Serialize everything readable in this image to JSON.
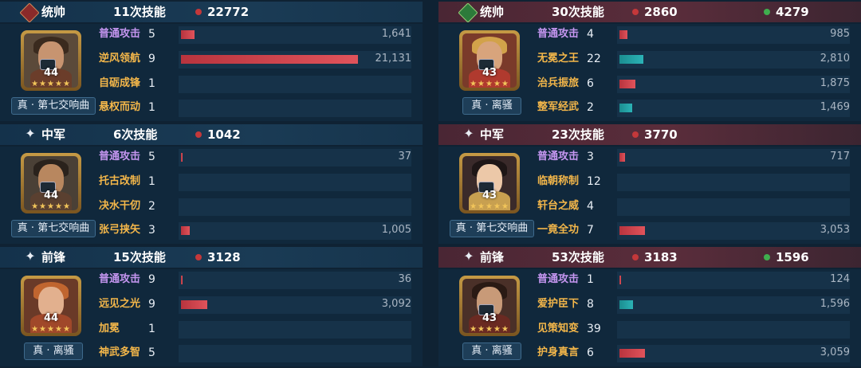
{
  "colors": {
    "left_header": "#1a3b55",
    "right_header": "#5a2d3b",
    "damage_bar": "#d84a52",
    "heal_bar": "#2bb3b6",
    "damage_dot": "#c4383a",
    "heal_dot": "#3fae4e",
    "normal_skill": "#c596f0",
    "skill": "#f4b74a"
  },
  "left": {
    "commander": {
      "role": "统帅",
      "casts": "11次技能",
      "damage": "22772",
      "level": "44",
      "stars": "★★★★★",
      "tag": "真 · 第七交响曲",
      "skills": [
        {
          "name": "普通攻击",
          "count": "5",
          "value": "1,641",
          "bar_fraction": 0.078,
          "bar_type": "damage"
        },
        {
          "name": "逆风领航",
          "count": "9",
          "value": "21,131",
          "bar_fraction": 1.0,
          "bar_type": "damage"
        },
        {
          "name": "自砺成锋",
          "count": "1",
          "value": "",
          "bar_fraction": 0,
          "bar_type": "damage"
        },
        {
          "name": "悬权而动",
          "count": "1",
          "value": "",
          "bar_fraction": 0,
          "bar_type": "damage"
        }
      ]
    },
    "middle": {
      "role": "中军",
      "casts": "6次技能",
      "damage": "1042",
      "level": "44",
      "stars": "★★★★★",
      "tag": "真 · 第七交响曲",
      "skills": [
        {
          "name": "普通攻击",
          "count": "5",
          "value": "37",
          "bar_fraction": 0.005,
          "bar_type": "damage"
        },
        {
          "name": "托古改制",
          "count": "1",
          "value": "",
          "bar_fraction": 0,
          "bar_type": "damage"
        },
        {
          "name": "决水干仞",
          "count": "2",
          "value": "",
          "bar_fraction": 0,
          "bar_type": "damage"
        },
        {
          "name": "张弓挟矢",
          "count": "3",
          "value": "1,005",
          "bar_fraction": 0.05,
          "bar_type": "damage"
        }
      ]
    },
    "vanguard": {
      "role": "前锋",
      "casts": "15次技能",
      "damage": "3128",
      "level": "44",
      "stars": "★★★★★",
      "tag": "真 · 离骚",
      "skills": [
        {
          "name": "普通攻击",
          "count": "9",
          "value": "36",
          "bar_fraction": 0.005,
          "bar_type": "damage"
        },
        {
          "name": "远见之光",
          "count": "9",
          "value": "3,092",
          "bar_fraction": 0.15,
          "bar_type": "damage"
        },
        {
          "name": "加冕",
          "count": "1",
          "value": "",
          "bar_fraction": 0,
          "bar_type": "damage"
        },
        {
          "name": "神武多智",
          "count": "5",
          "value": "",
          "bar_fraction": 0,
          "bar_type": "damage"
        }
      ]
    }
  },
  "right": {
    "commander": {
      "role": "统帅",
      "casts": "30次技能",
      "damage": "2860",
      "heal": "4279",
      "level": "43",
      "stars": "★★★★★",
      "tag": "真 · 离骚",
      "skills": [
        {
          "name": "普通攻击",
          "count": "4",
          "value": "985",
          "bar_fraction": 0.045,
          "bar_type": "damage"
        },
        {
          "name": "无冕之王",
          "count": "22",
          "value": "2,810",
          "bar_fraction": 0.135,
          "bar_type": "heal"
        },
        {
          "name": "治兵振旅",
          "count": "6",
          "value": "1,875",
          "bar_fraction": 0.09,
          "bar_type": "damage"
        },
        {
          "name": "整军经武",
          "count": "2",
          "value": "1,469",
          "bar_fraction": 0.07,
          "bar_type": "heal"
        }
      ]
    },
    "middle": {
      "role": "中军",
      "casts": "23次技能",
      "damage": "3770",
      "level": "43",
      "stars": "★★★★★",
      "tag": "真 · 第七交响曲",
      "skills": [
        {
          "name": "普通攻击",
          "count": "3",
          "value": "717",
          "bar_fraction": 0.033,
          "bar_type": "damage"
        },
        {
          "name": "临朝称制",
          "count": "12",
          "value": "",
          "bar_fraction": 0,
          "bar_type": "damage"
        },
        {
          "name": "轩台之威",
          "count": "4",
          "value": "",
          "bar_fraction": 0,
          "bar_type": "damage"
        },
        {
          "name": "一竟全功",
          "count": "7",
          "value": "3,053",
          "bar_fraction": 0.145,
          "bar_type": "damage"
        }
      ]
    },
    "vanguard": {
      "role": "前锋",
      "casts": "53次技能",
      "damage": "3183",
      "heal": "1596",
      "level": "43",
      "stars": "★★★★★",
      "tag": "真 · 离骚",
      "skills": [
        {
          "name": "普通攻击",
          "count": "1",
          "value": "124",
          "bar_fraction": 0.005,
          "bar_type": "damage"
        },
        {
          "name": "爱护臣下",
          "count": "8",
          "value": "1,596",
          "bar_fraction": 0.076,
          "bar_type": "heal"
        },
        {
          "name": "见策知变",
          "count": "39",
          "value": "",
          "bar_fraction": 0,
          "bar_type": "damage"
        },
        {
          "name": "护身真言",
          "count": "6",
          "value": "3,059",
          "bar_fraction": 0.145,
          "bar_type": "damage"
        }
      ]
    }
  }
}
